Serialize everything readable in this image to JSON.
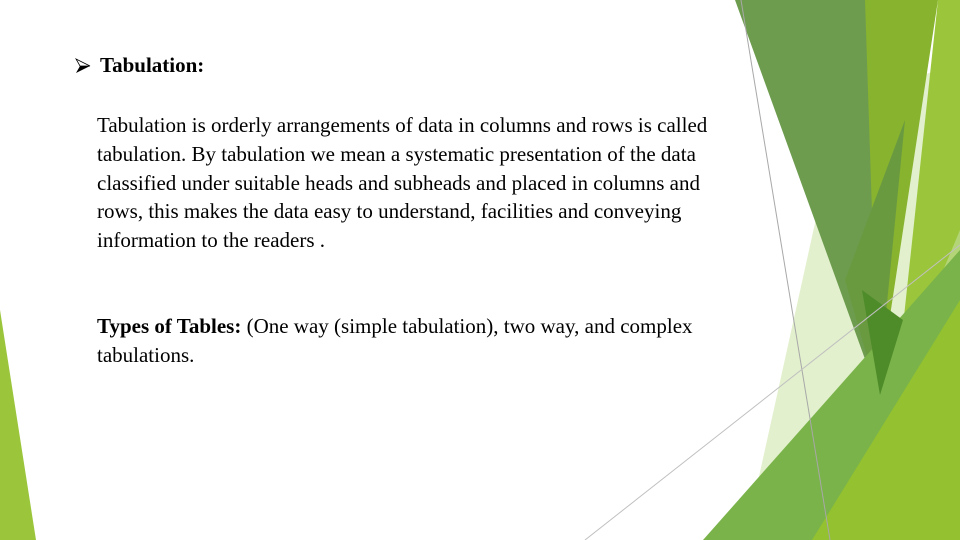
{
  "slide": {
    "bullet_icon": "arrow-bullet-icon",
    "title": "Tabulation:",
    "paragraph": "Tabulation is orderly arrangements of data in columns and rows is called tabulation. By tabulation we mean a systematic presentation of the data classified under suitable heads and subheads and placed in columns and rows, this makes the data easy to understand, facilities and conveying information to the readers .",
    "types_label": "Types of Tables:",
    "types_text": " (One way (simple tabulation), two way, and complex tabulations."
  },
  "theme": {
    "colors": {
      "green_dark": "#6e9c4f",
      "green_olive": "#6a9a40",
      "green_yellow": "#88b32e",
      "green_bright": "#9bc63b",
      "green_pale": "#dfeec8",
      "green_medium": "#7ab34a",
      "green_lime": "#93c12f",
      "green_deep": "#4e8c2a",
      "line_gray": "#b0b0b0"
    }
  }
}
